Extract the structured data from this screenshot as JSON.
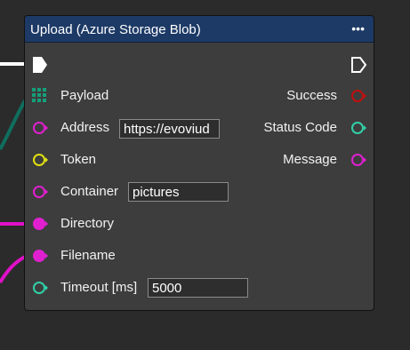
{
  "node": {
    "title": "Upload (Azure Storage Blob)",
    "menu_label": "•••",
    "header_color": "#1d3a66"
  },
  "inputs": {
    "payload": {
      "label": "Payload"
    },
    "address": {
      "label": "Address",
      "value": "https://evoviud"
    },
    "token": {
      "label": "Token"
    },
    "container": {
      "label": "Container",
      "value": "pictures"
    },
    "directory": {
      "label": "Directory"
    },
    "filename": {
      "label": "Filename"
    },
    "timeout": {
      "label": "Timeout [ms]",
      "value": "5000"
    }
  },
  "outputs": {
    "success": {
      "label": "Success"
    },
    "status_code": {
      "label": "Status Code"
    },
    "message": {
      "label": "Message"
    }
  },
  "pin_colors": {
    "exec": "#ffffff",
    "payload": "#14a07a",
    "string": "#e020d0",
    "token": "#e0e010",
    "number": "#30d0a8",
    "success": "#c01010",
    "wire_exec": "#ffffff",
    "wire_teal": "#0f6f5f",
    "wire_magenta": "#e010c8"
  },
  "icons": {
    "exec_in": "exec-arrow-icon",
    "exec_out": "exec-arrow-outline-icon",
    "payload": "grid-pin-icon",
    "menu": "ellipsis-icon"
  }
}
